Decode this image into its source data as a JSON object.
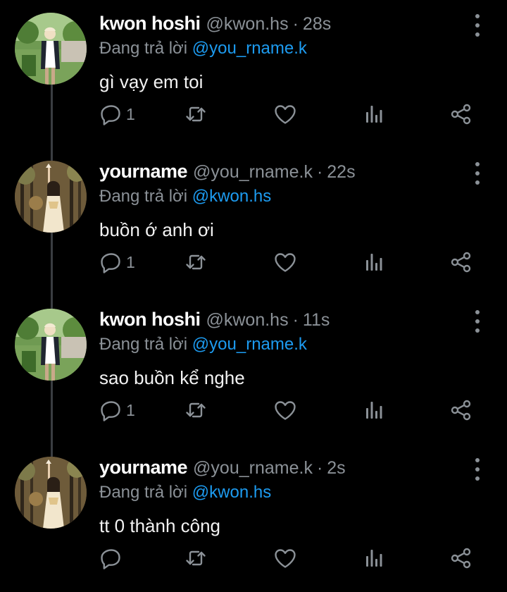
{
  "tweets": [
    {
      "name": "kwon hoshi",
      "handle": "@kwon.hs",
      "time": "28s",
      "replying_prefix": "Đang trả lời",
      "replying_to": "@you_rname.k",
      "text": "gì vạy em toi",
      "reply_count": "1",
      "avatar": "boy-standing-outdoors"
    },
    {
      "name": "yourname",
      "handle": "@you_rname.k",
      "time": "22s",
      "replying_prefix": "Đang trả lời",
      "replying_to": "@kwon.hs",
      "text": "buồn ớ anh ơi",
      "reply_count": "1",
      "avatar": "girl-in-forest"
    },
    {
      "name": "kwon hoshi",
      "handle": "@kwon.hs",
      "time": "11s",
      "replying_prefix": "Đang trả lời",
      "replying_to": "@you_rname.k",
      "text": "sao buồn kể nghe",
      "reply_count": "1",
      "avatar": "boy-standing-outdoors"
    },
    {
      "name": "yourname",
      "handle": "@you_rname.k",
      "time": "2s",
      "replying_prefix": "Đang trả lời",
      "replying_to": "@kwon.hs",
      "text": "tt 0 thành công",
      "reply_count": "",
      "avatar": "girl-in-forest"
    }
  ],
  "separator": "·",
  "icons": {
    "reply": "reply-icon",
    "retweet": "retweet-icon",
    "like": "heart-icon",
    "stats": "stats-icon",
    "share": "share-icon",
    "more": "more-vertical-icon"
  },
  "colors": {
    "background": "#000000",
    "text": "#e7e9ea",
    "secondary": "#8b9197",
    "link": "#1d9bf0",
    "thread_line": "#3a3d41"
  }
}
